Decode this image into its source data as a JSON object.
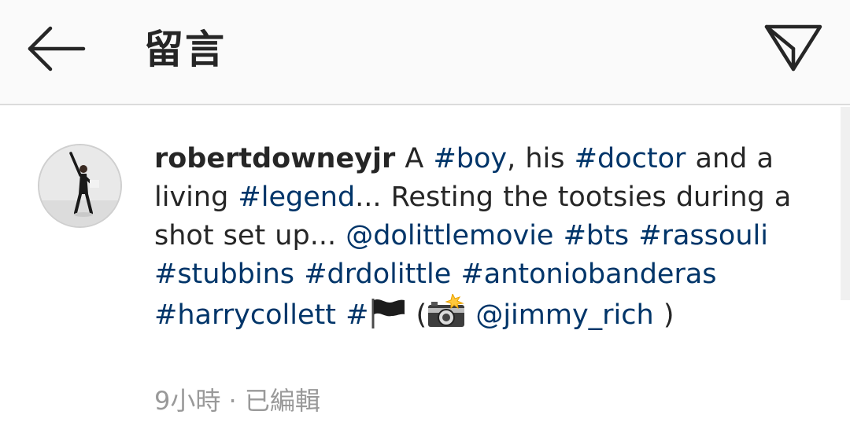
{
  "header": {
    "title": "留言"
  },
  "comment": {
    "username": "robertdowneyjr",
    "caption_parts": [
      {
        "text": " A ",
        "type": "text"
      },
      {
        "text": "#boy",
        "type": "tag"
      },
      {
        "text": ", his ",
        "type": "text"
      },
      {
        "text": "#doctor",
        "type": "tag"
      },
      {
        "text": " and a living ",
        "type": "text"
      },
      {
        "text": "#legend",
        "type": "tag"
      },
      {
        "text": "... Resting the tootsies during a shot set up... ",
        "type": "text"
      },
      {
        "text": "@dolittlemovie",
        "type": "tag"
      },
      {
        "text": " ",
        "type": "text"
      },
      {
        "text": "#bts",
        "type": "tag"
      },
      {
        "text": " ",
        "type": "text"
      },
      {
        "text": "#rassouli",
        "type": "tag"
      },
      {
        "text": " ",
        "type": "text"
      },
      {
        "text": "#stubbins",
        "type": "tag"
      },
      {
        "text": " ",
        "type": "text"
      },
      {
        "text": "#drdolittle",
        "type": "tag"
      },
      {
        "text": " ",
        "type": "text"
      },
      {
        "text": "#antoniobanderas",
        "type": "tag"
      },
      {
        "text": " ",
        "type": "text"
      },
      {
        "text": "#harrycollett",
        "type": "tag"
      },
      {
        "text": " ",
        "type": "text"
      },
      {
        "text": "#",
        "type": "tag"
      },
      {
        "text": "flag-icon",
        "type": "icon"
      },
      {
        "text": " (",
        "type": "text"
      },
      {
        "text": "camera-flash-icon",
        "type": "icon"
      },
      {
        "text": " ",
        "type": "text"
      },
      {
        "text": "@jimmy_rich",
        "type": "tag"
      },
      {
        "text": " )",
        "type": "text"
      }
    ],
    "time": "9小時",
    "separator": " · ",
    "edited": "已編輯"
  },
  "colors": {
    "text": "#262626",
    "link": "#003569",
    "meta": "#999999",
    "header_bg": "#fafafa"
  }
}
